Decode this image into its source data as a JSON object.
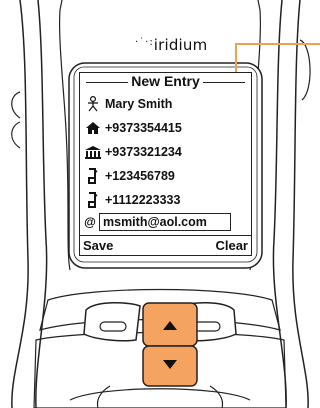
{
  "brand": {
    "logo_dots": "·˙·:",
    "name": "iridium"
  },
  "screen": {
    "title": "New Entry",
    "entries": [
      {
        "icon": "person-icon",
        "text": "Mary Smith"
      },
      {
        "icon": "home-phone-icon",
        "text": "+9373354415"
      },
      {
        "icon": "office-phone-icon",
        "text": "+9373321234"
      },
      {
        "icon": "mobile-phone-icon",
        "text": "+123456789"
      },
      {
        "icon": "mobile-phone-icon",
        "text": "+1112223333"
      },
      {
        "icon": "email-icon",
        "text": "msmith@aol.com",
        "prefix": "@"
      }
    ],
    "softkeys": {
      "left": "Save",
      "right": "Clear"
    }
  },
  "keys": {
    "up_arrow": "▲",
    "down_arrow": "▼"
  },
  "colors": {
    "highlight": "#F4A460",
    "highlight_stroke": "#F39C4A",
    "callout": "#F0A050"
  }
}
